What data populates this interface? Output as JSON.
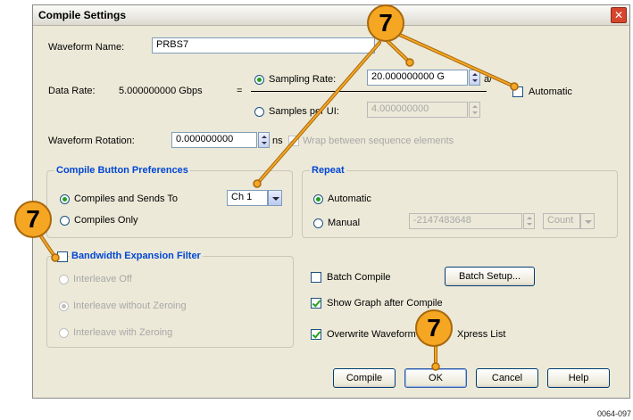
{
  "window": {
    "title": "Compile Settings",
    "close_glyph": "✕"
  },
  "waveform": {
    "name_label": "Waveform Name:",
    "name_value": "PRBS7"
  },
  "data_rate": {
    "label": "Data Rate:",
    "value": "5.000000000 Gbps",
    "equals": "=",
    "sampling_rate_label": "Sampling Rate:",
    "sampling_rate_value": "20.000000000 G",
    "sampling_rate_trail": "a/",
    "samples_per_ui_label": "Samples per UI:",
    "samples_per_ui_value": "4.000000000",
    "automatic_label": "Automatic"
  },
  "rotation": {
    "label": "Waveform Rotation:",
    "value": "0.000000000",
    "unit": "ns",
    "wrap_label": "Wrap between sequence elements"
  },
  "compile_prefs": {
    "title": "Compile Button Preferences",
    "option_send_label": "Compiles and Sends To",
    "channel_value": "Ch 1",
    "option_only_label": "Compiles Only"
  },
  "repeat": {
    "title": "Repeat",
    "automatic_label": "Automatic",
    "manual_label": "Manual",
    "manual_value": "-2147483648",
    "count_value": "Count"
  },
  "bandwidth": {
    "title": "Bandwidth Expansion Filter",
    "interleave_off": "Interleave Off",
    "interleave_without_zeroing": "Interleave without Zeroing",
    "interleave_with_zeroing": "Interleave with Zeroing"
  },
  "batch": {
    "batch_compile_label": "Batch Compile",
    "batch_setup_label": "Batch Setup...",
    "show_graph_label": "Show Graph after Compile",
    "overwrite_label_part1": "Overwrite Waveform",
    "overwrite_label_part2": "Xpress List"
  },
  "buttons": {
    "compile": "Compile",
    "ok": "OK",
    "cancel": "Cancel",
    "help": "Help"
  },
  "callouts": {
    "number": "7"
  },
  "figure_id": "0064-097",
  "colors": {
    "callout_fill": "#f5a623",
    "group_title": "#0046d5",
    "radio_dot": "#21a121"
  }
}
